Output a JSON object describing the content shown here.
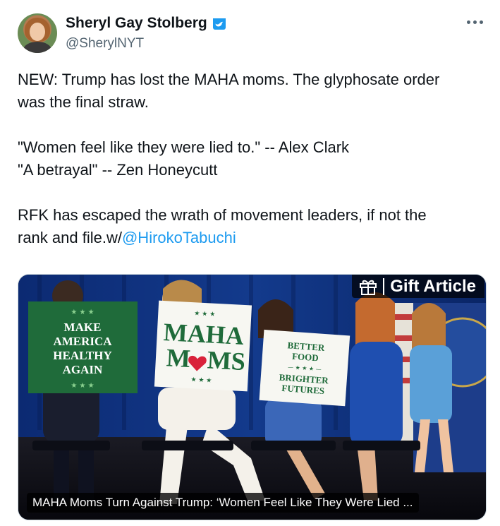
{
  "author": {
    "name": "Sheryl Gay Stolberg",
    "handle": "@SherylNYT",
    "verified_color": "#1d9bf0"
  },
  "tweet": {
    "line1": "NEW: Trump has lost the MAHA moms. The glyphosate order",
    "line2": "was the final straw.",
    "quote1": "\"Women feel like they were lied to.\" -- Alex Clark",
    "quote2": "\"A betrayal\"  -- Zen Honeycutt",
    "line3": "RFK has escaped the wrath of movement leaders, if not the",
    "line4_prefix": "rank and file.w/",
    "mention": "@HirokoTabuchi",
    "mention_color": "#1d9bf0"
  },
  "media": {
    "gift_label": "Gift Article",
    "caption": "MAHA Moms Turn Against Trump: ‘Women Feel Like They Were Lied ...",
    "signs": {
      "green_line1": "MAKE",
      "green_line2": "AMERICA",
      "green_line3": "HEALTHY",
      "green_line4": "AGAIN",
      "maha_line1": "MAHA",
      "maha_line2_left": "M",
      "maha_line2_right": "MS",
      "better_line1": "BETTER",
      "better_line2": "FOOD",
      "better_line3": "BRIGHTER",
      "better_line4": "FUTURES"
    }
  },
  "icons": {
    "more": "more-horizontal-icon",
    "verified": "verified-badge-icon",
    "gift": "gift-icon"
  }
}
